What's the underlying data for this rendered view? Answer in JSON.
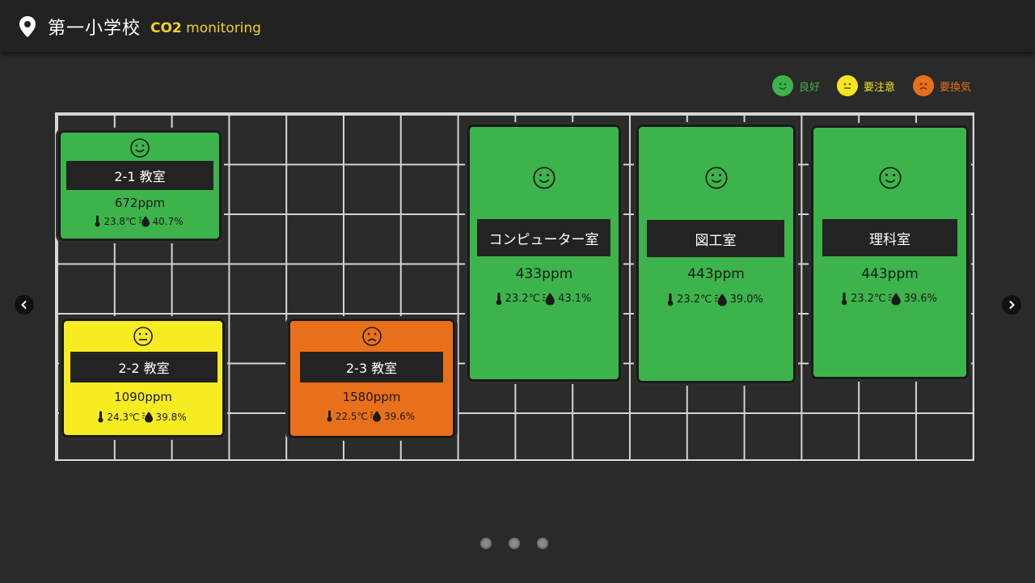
{
  "header": {
    "location_icon": "map-pin-icon",
    "school_name": "第一小学校",
    "tag_code": "CO2",
    "tag_text": "monitoring"
  },
  "legend": [
    {
      "label": "良好",
      "icon": "smile-face-icon",
      "color": "#3cb44b"
    },
    {
      "label": "要注意",
      "icon": "neutral-face-icon",
      "color": "#f5e51e"
    },
    {
      "label": "要換気",
      "icon": "frown-face-icon",
      "color": "#e8701a"
    }
  ],
  "rooms": [
    {
      "name": "2-1 教室",
      "ppm": "672ppm",
      "temp": "23.8℃",
      "humidity": "40.7%",
      "status": "good",
      "color": "#3cb44b"
    },
    {
      "name": "2-2 教室",
      "ppm": "1090ppm",
      "temp": "24.3℃",
      "humidity": "39.8%",
      "status": "caution",
      "color": "#f7eb22"
    },
    {
      "name": "2-3 教室",
      "ppm": "1580ppm",
      "temp": "22.5℃",
      "humidity": "39.6%",
      "status": "ventilate",
      "color": "#e8701a"
    },
    {
      "name": "コンピューター室",
      "ppm": "433ppm",
      "temp": "23.2℃",
      "humidity": "43.1%",
      "status": "good",
      "color": "#3cb44b"
    },
    {
      "name": "図工室",
      "ppm": "443ppm",
      "temp": "23.2℃",
      "humidity": "39.0%",
      "status": "good",
      "color": "#3cb44b"
    },
    {
      "name": "理科室",
      "ppm": "443ppm",
      "temp": "23.2℃",
      "humidity": "39.6%",
      "status": "good",
      "color": "#3cb44b"
    }
  ],
  "carousel": {
    "pages": 3,
    "prev_icon": "chevron-left-icon",
    "next_icon": "chevron-right-icon"
  }
}
